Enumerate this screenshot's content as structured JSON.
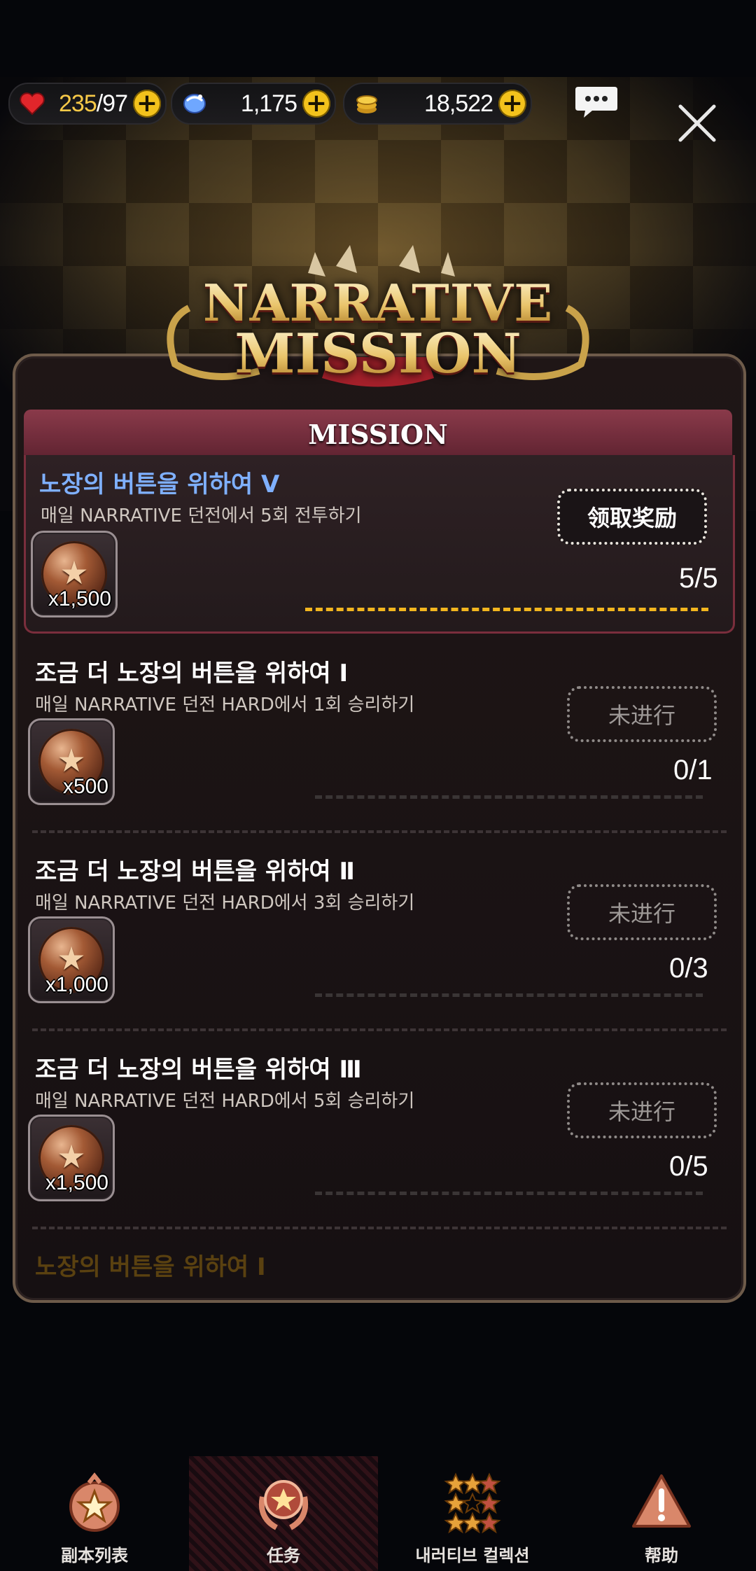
{
  "resources": {
    "stamina": {
      "current": "235",
      "sep": "/97",
      "icon": "heart-icon"
    },
    "gems": {
      "value": "1,175",
      "icon": "gem-icon"
    },
    "gold": {
      "value": "18,522",
      "icon": "gold-coin-icon"
    }
  },
  "header": {
    "logo_line1": "NARRATIVE",
    "logo_line2": "MISSION",
    "section": "MISSION"
  },
  "missions": [
    {
      "title": "노장의 버튼을 위하여 Ⅴ",
      "desc": "매일 NARRATIVE 던전에서 5회 전투하기",
      "reward_qty": "x1,500",
      "button": "领取奖励",
      "progress": "5/5",
      "fill": 1.0
    },
    {
      "title": "조금 더 노장의 버튼을 위하여 Ⅰ",
      "desc": "매일 NARRATIVE 던전 HARD에서 1회 승리하기",
      "reward_qty": "x500",
      "button": "未进行",
      "progress": "0/1",
      "fill": 0.0
    },
    {
      "title": "조금 더 노장의 버튼을 위하여 Ⅱ",
      "desc": "매일 NARRATIVE 던전 HARD에서 3회 승리하기",
      "reward_qty": "x1,000",
      "button": "未进行",
      "progress": "0/3",
      "fill": 0.0
    },
    {
      "title": "조금 더 노장의 버튼을 위하여 Ⅲ",
      "desc": "매일 NARRATIVE 던전 HARD에서 5회 승리하기",
      "reward_qty": "x1,500",
      "button": "未进行",
      "progress": "0/5",
      "fill": 0.0
    },
    {
      "title": "노장의 버튼을 위하여 Ⅰ"
    }
  ],
  "nav": [
    {
      "label": "副本列表",
      "icon": "dungeon-list-icon"
    },
    {
      "label": "任务",
      "icon": "mission-medal-icon"
    },
    {
      "label": "내러티브 컬렉션",
      "icon": "stars-collection-icon"
    },
    {
      "label": "帮助",
      "icon": "help-warning-icon"
    }
  ],
  "colors": {
    "accent": "#f3c21c",
    "mission_header": "#7a2e3c",
    "title_highlight": "#7fb0ff",
    "progress_done": "#f3b61f"
  }
}
